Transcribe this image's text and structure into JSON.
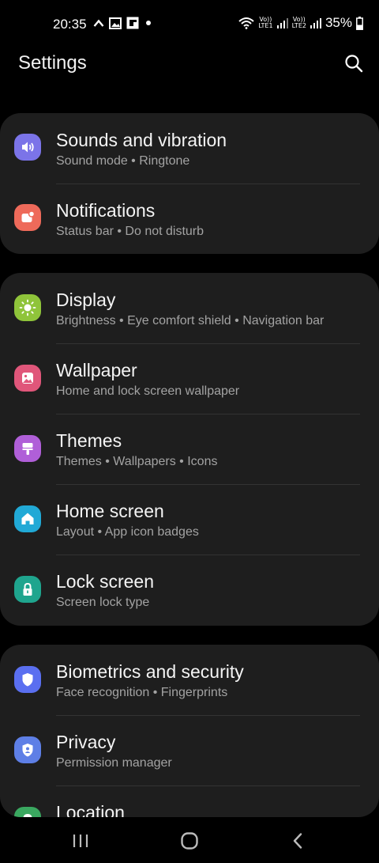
{
  "status_bar": {
    "time": "20:35",
    "lte1_top": "Vo))",
    "lte1_bottom": "LTE1",
    "lte2_top": "Vo))",
    "lte2_bottom": "LTE2",
    "battery_percent": "35%",
    "left_icons": [
      "chevron-up-icon",
      "image-icon",
      "flipboard-icon",
      "dot-icon"
    ],
    "right_icons": [
      "wifi-icon",
      "signal-icon",
      "signal-icon",
      "battery-icon"
    ]
  },
  "header": {
    "title": "Settings",
    "search_icon": "search-icon"
  },
  "groups": [
    {
      "items": [
        {
          "title": "Sounds and vibration",
          "subtitle": "Sound mode  •  Ringtone",
          "icon": "volume-icon",
          "color": "#7b74e8"
        },
        {
          "title": "Notifications",
          "subtitle": "Status bar  •  Do not disturb",
          "icon": "notification-icon",
          "color": "#ee6a5a"
        }
      ]
    },
    {
      "items": [
        {
          "title": "Display",
          "subtitle": "Brightness  •  Eye comfort shield  •  Navigation bar",
          "icon": "sun-icon",
          "color": "#8fc43a"
        },
        {
          "title": "Wallpaper",
          "subtitle": "Home and lock screen wallpaper",
          "icon": "image-icon",
          "color": "#e0567a"
        },
        {
          "title": "Themes",
          "subtitle": "Themes  •  Wallpapers  •  Icons",
          "icon": "brush-icon",
          "color": "#b05fd8"
        },
        {
          "title": "Home screen",
          "subtitle": "Layout  •  App icon badges",
          "icon": "home-icon",
          "color": "#21a9d6"
        },
        {
          "title": "Lock screen",
          "subtitle": "Screen lock type",
          "icon": "lock-icon",
          "color": "#1fa58e"
        }
      ]
    },
    {
      "items": [
        {
          "title": "Biometrics and security",
          "subtitle": "Face recognition  •  Fingerprints",
          "icon": "shield-icon",
          "color": "#5a6ff0"
        },
        {
          "title": "Privacy",
          "subtitle": "Permission manager",
          "icon": "privacy-shield-icon",
          "color": "#5e7fe6"
        },
        {
          "title": "Location",
          "subtitle": "",
          "icon": "location-icon",
          "color": "#3aa860"
        }
      ]
    }
  ],
  "nav_bar": {
    "recents_icon": "recents-icon",
    "home_icon": "home-button-icon",
    "back_icon": "back-icon"
  }
}
